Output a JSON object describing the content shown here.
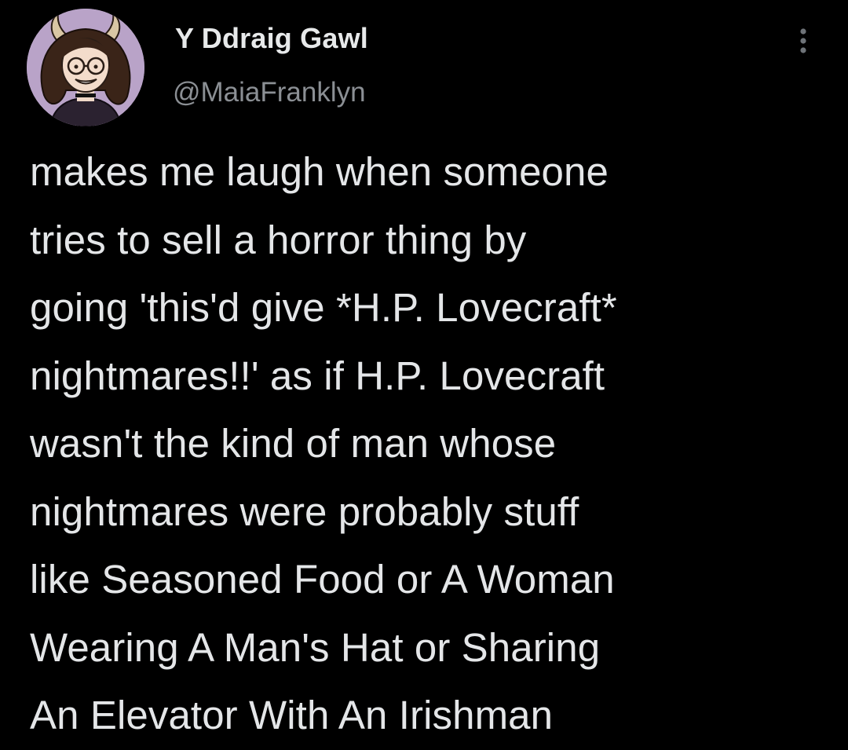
{
  "tweet": {
    "author": {
      "display_name": "Y Ddraig Gawl",
      "handle": "@MaiaFranklyn",
      "avatar_icon": "avatar-illustration-horned-woman-glasses"
    },
    "more_icon": "more-options-vertical-dots-icon",
    "text_lines": [
      "makes me laugh when someone",
      "tries to sell a horror thing by",
      "going 'this'd give *H.P. Lovecraft*",
      "nightmares!!' as if H.P. Lovecraft",
      "wasn't the kind of man whose",
      "nightmares were probably stuff",
      "like Seasoned Food or A Woman",
      "Wearing A Man's Hat or Sharing",
      "An Elevator With An Irishman"
    ]
  },
  "colors": {
    "background": "#000000",
    "primary_text": "#e7e9ea",
    "secondary_text": "#8b8f94",
    "avatar_background": "#b9a3c8"
  }
}
